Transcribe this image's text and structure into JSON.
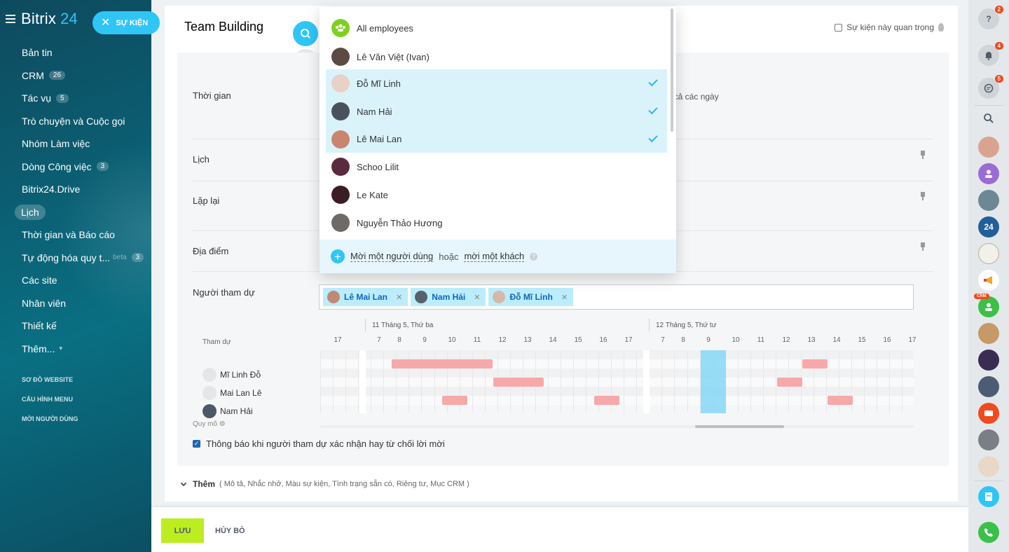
{
  "sidebar": {
    "logo": "Bitrix",
    "logo_num": "24",
    "event_button": "SỰ KIỆN",
    "items": [
      {
        "label": "Bản tin",
        "count": ""
      },
      {
        "label": "CRM",
        "count": "26"
      },
      {
        "label": "Tác vụ",
        "count": "5"
      },
      {
        "label": "Trò chuyện và Cuộc gọi",
        "count": ""
      },
      {
        "label": "Nhóm Làm việc",
        "count": ""
      },
      {
        "label": "Dòng Công việc",
        "count": "3"
      },
      {
        "label": "Bitrix24.Drive",
        "count": ""
      },
      {
        "label": "Lịch",
        "count": ""
      },
      {
        "label": "Thời gian và Báo cáo",
        "count": ""
      },
      {
        "label": "Tự động hóa quy t...",
        "count": "3",
        "beta": "beta"
      },
      {
        "label": "Các site",
        "count": ""
      },
      {
        "label": "Nhân viên",
        "count": ""
      },
      {
        "label": "Thiết kế",
        "count": ""
      },
      {
        "label": "Thêm...",
        "count": ""
      }
    ],
    "small_items": [
      "SƠ ĐỒ WEBSITE",
      "CẤU HÌNH MENU",
      "MỜI NGƯỜI DÙNG"
    ]
  },
  "form": {
    "title": "Team Building",
    "important_label": "Sự kiện này quan trọng",
    "all_day": "Tất cả các ngày",
    "rows": {
      "time": "Thời gian",
      "calendar": "Lịch",
      "repeat": "Lặp lại",
      "location": "Địa điểm",
      "attendees": "Người tham dự"
    },
    "chips": [
      {
        "name": "Lê Mai Lan"
      },
      {
        "name": "Nam Hải"
      },
      {
        "name": "Đỗ Mĩ Linh"
      }
    ],
    "planner": {
      "date1": "11 Tháng 5, Thứ ba",
      "date2": "12 Tháng 5, Thứ tư",
      "attend_label": "Tham dự",
      "hours_day0": [
        "17"
      ],
      "hours_day1": [
        "7",
        "8",
        "9",
        "10",
        "11",
        "12",
        "13",
        "14",
        "15",
        "16",
        "17"
      ],
      "hours_day2": [
        "7",
        "8",
        "9",
        "10",
        "11",
        "12",
        "13",
        "14",
        "15",
        "16",
        "17"
      ],
      "users": [
        "Mĩ Linh Đỗ",
        "Mai Lan Lê",
        "Nam Hải"
      ],
      "busy": [
        [
          {
            "day": 1,
            "from": 8.0,
            "to": 12.0
          },
          {
            "day": 2,
            "from": 13.0,
            "to": 14.0
          }
        ],
        [
          {
            "day": 1,
            "from": 12.0,
            "to": 14.0
          },
          {
            "day": 2,
            "from": 12.0,
            "to": 13.0
          }
        ],
        [
          {
            "day": 1,
            "from": 10.0,
            "to": 11.0
          },
          {
            "day": 1,
            "from": 16.0,
            "to": 17.0
          },
          {
            "day": 2,
            "from": 14.0,
            "to": 15.0
          }
        ]
      ],
      "selected": {
        "day": 2,
        "from": 9.0,
        "to": 10.0
      }
    },
    "scale": "Quy mô",
    "notify_label": "Thông báo khi người tham dự xác nhận hay từ chối lời mời",
    "more_title": "Thêm",
    "more_items": "( Mô tả,  Nhắc nhở,  Màu sự kiện,  Tình trạng sẵn có,  Riêng tư,  Mục CRM )"
  },
  "dropdown": {
    "items": [
      {
        "name": "All employees",
        "selected": false
      },
      {
        "name": "Lê Văn Việt (Ivan)",
        "selected": false
      },
      {
        "name": "Đỗ Mĩ Linh",
        "selected": true
      },
      {
        "name": "Nam Hải",
        "selected": true
      },
      {
        "name": "Lê Mai Lan",
        "selected": true
      },
      {
        "name": "Schoo Lilit",
        "selected": false
      },
      {
        "name": "Le Kate",
        "selected": false
      },
      {
        "name": "Nguyễn Thảo Hương",
        "selected": false
      }
    ],
    "invite_user": "Mời một người dùng",
    "or": "hoặc",
    "invite_guest": "mời một khách"
  },
  "footer": {
    "save": "LƯU",
    "cancel": "HỦY BỎ"
  },
  "rightbar": {
    "badges": {
      "help": "2",
      "notifications": "4",
      "chat": "5"
    },
    "crm_tag": "CRM",
    "b24": "24"
  },
  "colors": {
    "accent": "#2fc6f6",
    "save": "#bbed21",
    "busy": "#f7a8a8",
    "selected_row": "#daf3fb",
    "chip": "#bcedfc"
  }
}
